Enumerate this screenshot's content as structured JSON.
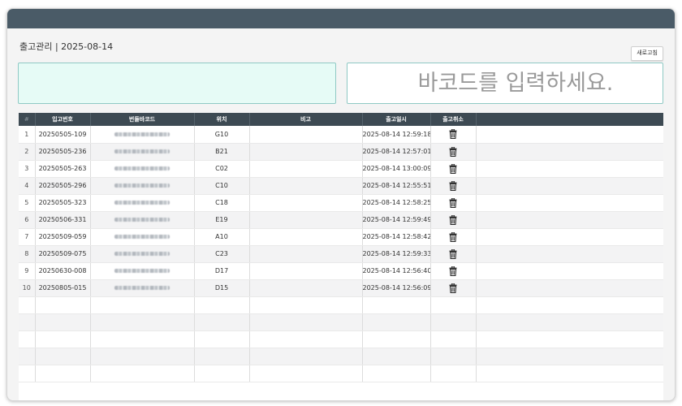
{
  "page": {
    "title": "출고관리 | 2025-08-14"
  },
  "toolbar": {
    "refresh_label": "새로고침"
  },
  "barcode": {
    "placeholder": "바코드를 입력하세요."
  },
  "table": {
    "headers": [
      "#",
      "입고번호",
      "번들바코드",
      "위치",
      "비고",
      "출고일시",
      "출고취소"
    ],
    "rows": [
      {
        "no": "1",
        "receipt": "20250505-109",
        "location": "G10",
        "note": "",
        "datetime": "2025-08-14 12:59:18"
      },
      {
        "no": "2",
        "receipt": "20250505-236",
        "location": "B21",
        "note": "",
        "datetime": "2025-08-14 12:57:01"
      },
      {
        "no": "3",
        "receipt": "20250505-263",
        "location": "C02",
        "note": "",
        "datetime": "2025-08-14 13:00:09"
      },
      {
        "no": "4",
        "receipt": "20250505-296",
        "location": "C10",
        "note": "",
        "datetime": "2025-08-14 12:55:51"
      },
      {
        "no": "5",
        "receipt": "20250505-323",
        "location": "C18",
        "note": "",
        "datetime": "2025-08-14 12:58:25"
      },
      {
        "no": "6",
        "receipt": "20250506-331",
        "location": "E19",
        "note": "",
        "datetime": "2025-08-14 12:59:49"
      },
      {
        "no": "7",
        "receipt": "20250509-059",
        "location": "A10",
        "note": "",
        "datetime": "2025-08-14 12:58:42"
      },
      {
        "no": "8",
        "receipt": "20250509-075",
        "location": "C23",
        "note": "",
        "datetime": "2025-08-14 12:59:33"
      },
      {
        "no": "9",
        "receipt": "20250630-008",
        "location": "D17",
        "note": "",
        "datetime": "2025-08-14 12:56:40"
      },
      {
        "no": "10",
        "receipt": "20250805-015",
        "location": "D15",
        "note": "",
        "datetime": "2025-08-14 12:56:09"
      }
    ],
    "delete_icon": "trash-icon"
  },
  "colors": {
    "titlebar": "#4a5b67",
    "table_header": "#3d4a53",
    "input_border": "#8fc9c4",
    "green_box": "#e6fbf6"
  }
}
